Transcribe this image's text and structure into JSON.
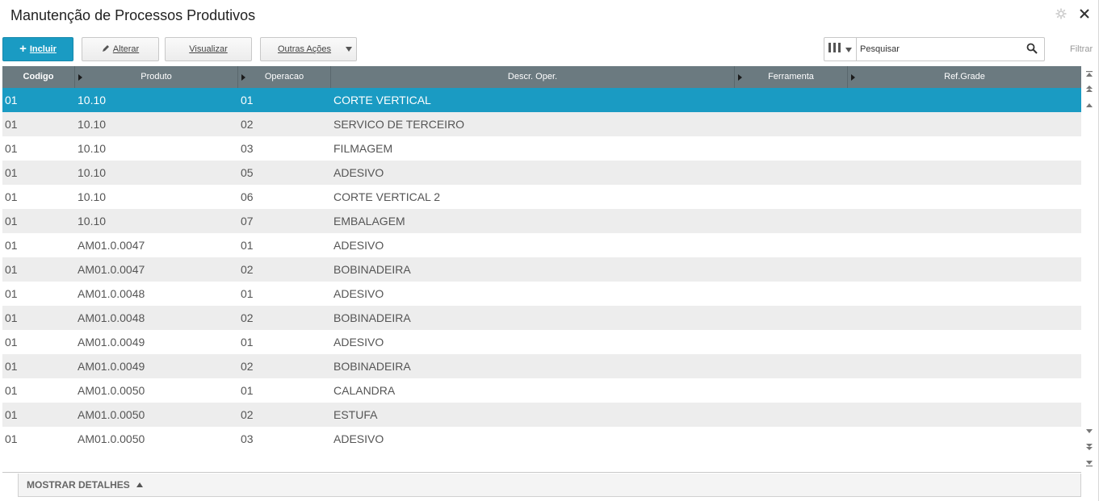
{
  "window": {
    "title": "Manutenção de Processos Produtivos"
  },
  "toolbar": {
    "incluir_label": "Incluir",
    "alterar_label": "Alterar",
    "visualizar_label": "Visualizar",
    "outras_label": "Outras Ações",
    "search_placeholder": "Pesquisar",
    "filtrar_label": "Filtrar"
  },
  "grid": {
    "columns": [
      "Codigo",
      "Produto",
      "Operacao",
      "Descr. Oper.",
      "Ferramenta",
      "Ref.Grade"
    ],
    "rows": [
      [
        "01",
        "10.10",
        "01",
        "CORTE VERTICAL"
      ],
      [
        "01",
        "10.10",
        "02",
        "SERVICO DE TERCEIRO"
      ],
      [
        "01",
        "10.10",
        "03",
        "FILMAGEM"
      ],
      [
        "01",
        "10.10",
        "05",
        "ADESIVO"
      ],
      [
        "01",
        "10.10",
        "06",
        "CORTE VERTICAL 2"
      ],
      [
        "01",
        "10.10",
        "07",
        "EMBALAGEM"
      ],
      [
        "01",
        "AM01.0.0047",
        "01",
        "ADESIVO"
      ],
      [
        "01",
        "AM01.0.0047",
        "02",
        "BOBINADEIRA"
      ],
      [
        "01",
        "AM01.0.0048",
        "01",
        "ADESIVO"
      ],
      [
        "01",
        "AM01.0.0048",
        "02",
        "BOBINADEIRA"
      ],
      [
        "01",
        "AM01.0.0049",
        "01",
        "ADESIVO"
      ],
      [
        "01",
        "AM01.0.0049",
        "02",
        "BOBINADEIRA"
      ],
      [
        "01",
        "AM01.0.0050",
        "01",
        "CALANDRA"
      ],
      [
        "01",
        "AM01.0.0050",
        "02",
        "ESTUFA"
      ],
      [
        "01",
        "AM01.0.0050",
        "03",
        "ADESIVO"
      ]
    ]
  },
  "footer": {
    "details_label": "MOSTRAR DETALHES"
  },
  "colors": {
    "accent": "#1a9bc3",
    "header_bg": "#6b7a80"
  },
  "icons": [
    "gear-icon",
    "close-icon",
    "pencil-icon",
    "columns-icon",
    "search-icon"
  ]
}
